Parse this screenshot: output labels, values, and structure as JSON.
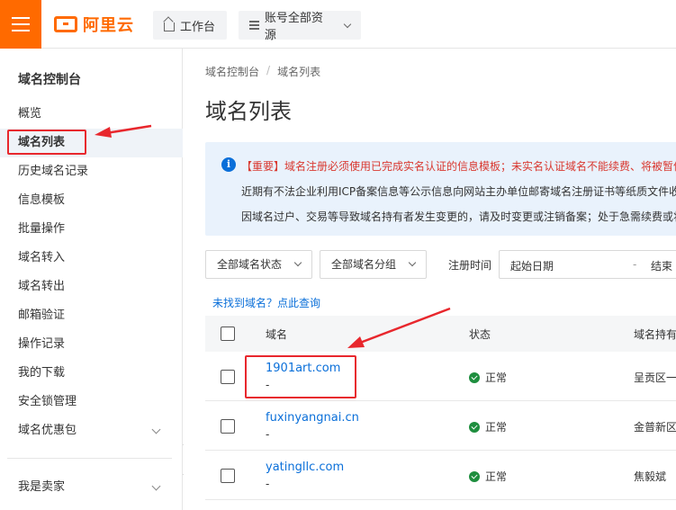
{
  "topbar": {
    "logo_text": "阿里云",
    "workbench_label": "工作台",
    "resources_label": "账号全部资源"
  },
  "sidebar": {
    "title": "域名控制台",
    "items": [
      {
        "label": "概览"
      },
      {
        "label": "域名列表"
      },
      {
        "label": "历史域名记录"
      },
      {
        "label": "信息模板"
      },
      {
        "label": "批量操作"
      },
      {
        "label": "域名转入"
      },
      {
        "label": "域名转出"
      },
      {
        "label": "邮箱验证"
      },
      {
        "label": "操作记录"
      },
      {
        "label": "我的下载"
      },
      {
        "label": "安全锁管理"
      },
      {
        "label": "域名优惠包"
      },
      {
        "label": "我是卖家"
      }
    ]
  },
  "breadcrumb": {
    "root": "域名控制台",
    "separator": "/",
    "current": "域名列表"
  },
  "page_title": "域名列表",
  "notice": {
    "line1": "【重要】域名注册必须使用已完成实名认证的信息模板；未实名认证域名不能续费、将被暂停",
    "line2": "近期有不法企业利用ICP备案信息等公示信息向网站主办单位邮寄域名注册证书等纸质文件收",
    "line3": "因域名过户、交易等导致域名持有者发生变更的，请及时变更或注销备案；处于急需续费或将"
  },
  "filters": {
    "status": "全部域名状态",
    "group": "全部域名分组",
    "reg_time_label": "注册时间",
    "start_date": "起始日期",
    "date_separator": "-",
    "end_date": "结束"
  },
  "find_link": "未找到域名？点此查询",
  "table": {
    "headers": {
      "domain": "域名",
      "status": "状态",
      "holder": "域名持有"
    },
    "rows": [
      {
        "domain": "1901art.com",
        "sub": "-",
        "status": "正常",
        "holder": "呈贡区一"
      },
      {
        "domain": "fuxinyangnai.cn",
        "sub": "-",
        "status": "正常",
        "holder": "金普新区"
      },
      {
        "domain": "yatingllc.com",
        "sub": "-",
        "status": "正常",
        "holder": "焦毅斌"
      }
    ]
  },
  "colors": {
    "brand": "#ff6a00",
    "link": "#0a6fd9",
    "annotation": "#e8272d",
    "ok": "#1e8e3e"
  }
}
